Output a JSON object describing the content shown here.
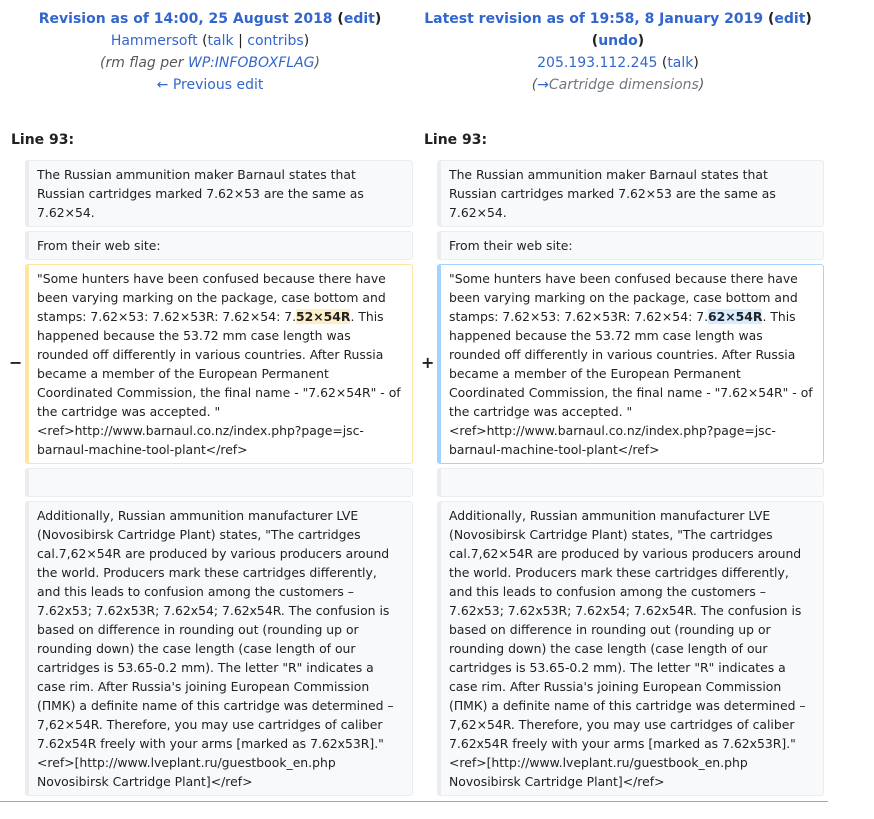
{
  "left_header": {
    "title": "Revision as of 14:00, 25 August 2018",
    "edit_label": "edit",
    "user": "Hammersoft",
    "talk": "talk",
    "contribs": "contribs",
    "summary_prefix": "(rm flag per ",
    "summary_link": "WP:INFOBOXFLAG",
    "summary_suffix": ")",
    "prev_edit": "← Previous edit"
  },
  "right_header": {
    "title": "Latest revision as of 19:58, 8 January 2019",
    "edit_label": "edit",
    "undo_label": "undo",
    "user": "205.193.112.245",
    "talk": "talk",
    "summary_arrow": "→",
    "summary_text": "Cartridge dimensions"
  },
  "diff": {
    "left_line": "Line 93:",
    "right_line": "Line 93:",
    "minus": "−",
    "plus": "+",
    "context1": "The Russian ammunition maker Barnaul states that Russian cartridges marked 7.62×53 are the same as 7.62×54.",
    "context2": "From their web site:",
    "old_pre": "\"Some hunters have been confused because there have been varying marking on the package, case bottom and stamps: 7.62×53: 7.62×53R: 7.62×54: 7.",
    "old_hl": "52×54R",
    "old_post": ". This happened because the 53.72 mm case length was rounded off differently in various countries. After Russia became a member of the European Permanent Coordinated Commission, the final name - \"7.62×54R\" - of the cartridge was accepted. \" <ref>http://www.barnaul.co.nz/index.php?page=jsc-barnaul-machine-tool-plant</ref>",
    "new_pre": "\"Some hunters have been confused because there have been varying marking on the package, case bottom and stamps: 7.62×53: 7.62×53R: 7.62×54: 7.",
    "new_hl": "62×54R",
    "new_post": ". This happened because the 53.72 mm case length was rounded off differently in various countries. After Russia became a member of the European Permanent Coordinated Commission, the final name - \"7.62×54R\" - of the cartridge was accepted. \" <ref>http://www.barnaul.co.nz/index.php?page=jsc-barnaul-machine-tool-plant</ref>",
    "context4": "Additionally, Russian ammunition manufacturer LVE (Novosibirsk Cartridge Plant) states, \"The cartridges cal.7,62×54R are produced by various producers around the world. Producers mark these cartridges differently, and this leads to confusion among the customers – 7.62x53; 7.62x53R; 7.62x54; 7.62x54R. The confusion is based on difference in rounding out (rounding up or rounding down) the case length (case length of our cartridges is 53.65-0.2 mm). The letter \"R\" indicates a case rim. After Russia's joining European Commission (ПМК) a definite name of this cartridge was determined – 7,62×54R. Therefore, you may use cartridges of caliber 7.62x54R freely with your arms [marked as 7.62x53R].\"<ref>[http://www.lveplant.ru/guestbook_en.php Novosibirsk Cartridge Plant]</ref>"
  }
}
